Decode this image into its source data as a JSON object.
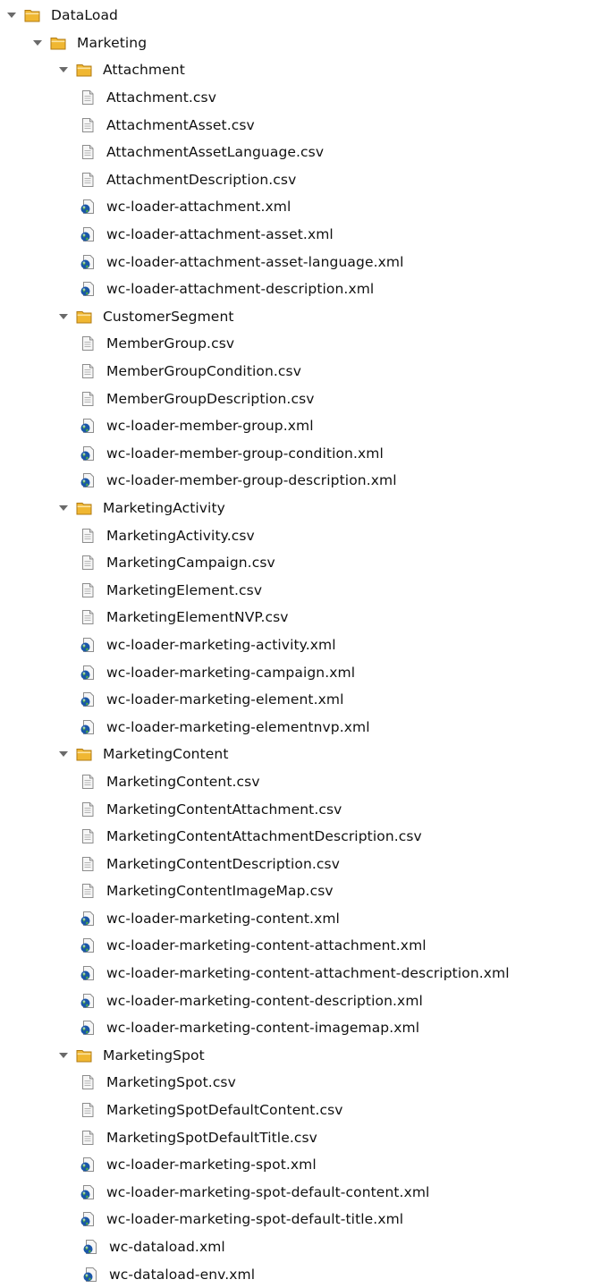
{
  "tree": [
    {
      "label": "DataLoad",
      "type": "folder",
      "depth": 0,
      "expanded": true
    },
    {
      "label": "Marketing",
      "type": "folder",
      "depth": 1,
      "expanded": true
    },
    {
      "label": "Attachment",
      "type": "folder",
      "depth": 2,
      "expanded": true
    },
    {
      "label": "Attachment.csv",
      "type": "csv",
      "depth": 3
    },
    {
      "label": "AttachmentAsset.csv",
      "type": "csv",
      "depth": 3
    },
    {
      "label": "AttachmentAssetLanguage.csv",
      "type": "csv",
      "depth": 3
    },
    {
      "label": "AttachmentDescription.csv",
      "type": "csv",
      "depth": 3
    },
    {
      "label": "wc-loader-attachment.xml",
      "type": "xml",
      "depth": 3
    },
    {
      "label": "wc-loader-attachment-asset.xml",
      "type": "xml",
      "depth": 3
    },
    {
      "label": "wc-loader-attachment-asset-language.xml",
      "type": "xml",
      "depth": 3
    },
    {
      "label": "wc-loader-attachment-description.xml",
      "type": "xml",
      "depth": 3
    },
    {
      "label": "CustomerSegment",
      "type": "folder",
      "depth": 2,
      "expanded": true
    },
    {
      "label": "MemberGroup.csv",
      "type": "csv",
      "depth": 3
    },
    {
      "label": "MemberGroupCondition.csv",
      "type": "csv",
      "depth": 3
    },
    {
      "label": "MemberGroupDescription.csv",
      "type": "csv",
      "depth": 3
    },
    {
      "label": "wc-loader-member-group.xml",
      "type": "xml",
      "depth": 3
    },
    {
      "label": "wc-loader-member-group-condition.xml",
      "type": "xml",
      "depth": 3
    },
    {
      "label": "wc-loader-member-group-description.xml",
      "type": "xml",
      "depth": 3
    },
    {
      "label": "MarketingActivity",
      "type": "folder",
      "depth": 2,
      "expanded": true
    },
    {
      "label": "MarketingActivity.csv",
      "type": "csv",
      "depth": 3
    },
    {
      "label": "MarketingCampaign.csv",
      "type": "csv",
      "depth": 3
    },
    {
      "label": "MarketingElement.csv",
      "type": "csv",
      "depth": 3
    },
    {
      "label": "MarketingElementNVP.csv",
      "type": "csv",
      "depth": 3
    },
    {
      "label": "wc-loader-marketing-activity.xml",
      "type": "xml",
      "depth": 3
    },
    {
      "label": "wc-loader-marketing-campaign.xml",
      "type": "xml",
      "depth": 3
    },
    {
      "label": "wc-loader-marketing-element.xml",
      "type": "xml",
      "depth": 3
    },
    {
      "label": "wc-loader-marketing-elementnvp.xml",
      "type": "xml",
      "depth": 3
    },
    {
      "label": "MarketingContent",
      "type": "folder",
      "depth": 2,
      "expanded": true
    },
    {
      "label": "MarketingContent.csv",
      "type": "csv",
      "depth": 3
    },
    {
      "label": "MarketingContentAttachment.csv",
      "type": "csv",
      "depth": 3
    },
    {
      "label": "MarketingContentAttachmentDescription.csv",
      "type": "csv",
      "depth": 3
    },
    {
      "label": "MarketingContentDescription.csv",
      "type": "csv",
      "depth": 3
    },
    {
      "label": "MarketingContentImageMap.csv",
      "type": "csv",
      "depth": 3
    },
    {
      "label": "wc-loader-marketing-content.xml",
      "type": "xml",
      "depth": 3
    },
    {
      "label": "wc-loader-marketing-content-attachment.xml",
      "type": "xml",
      "depth": 3
    },
    {
      "label": "wc-loader-marketing-content-attachment-description.xml",
      "type": "xml",
      "depth": 3
    },
    {
      "label": "wc-loader-marketing-content-description.xml",
      "type": "xml",
      "depth": 3
    },
    {
      "label": "wc-loader-marketing-content-imagemap.xml",
      "type": "xml",
      "depth": 3
    },
    {
      "label": "MarketingSpot",
      "type": "folder",
      "depth": 2,
      "expanded": true
    },
    {
      "label": "MarketingSpot.csv",
      "type": "csv",
      "depth": 3
    },
    {
      "label": "MarketingSpotDefaultContent.csv",
      "type": "csv",
      "depth": 3
    },
    {
      "label": "MarketingSpotDefaultTitle.csv",
      "type": "csv",
      "depth": 3
    },
    {
      "label": "wc-loader-marketing-spot.xml",
      "type": "xml",
      "depth": 3
    },
    {
      "label": "wc-loader-marketing-spot-default-content.xml",
      "type": "xml",
      "depth": 3
    },
    {
      "label": "wc-loader-marketing-spot-default-title.xml",
      "type": "xml",
      "depth": 3
    },
    {
      "label": "wc-dataload.xml",
      "type": "xml",
      "depth": 2
    },
    {
      "label": "wc-dataload-env.xml",
      "type": "xml",
      "depth": 2
    }
  ],
  "icons": {
    "folder": "folder-icon",
    "csv": "csv-file-icon",
    "xml": "xml-file-icon"
  },
  "colors": {
    "folder_fill": "#f0b732",
    "folder_edge": "#b27b12",
    "page_fill": "#f6f6f6",
    "page_edge": "#8d8d8d",
    "globe_blue": "#1a56a8",
    "globe_green": "#4fa84a"
  }
}
